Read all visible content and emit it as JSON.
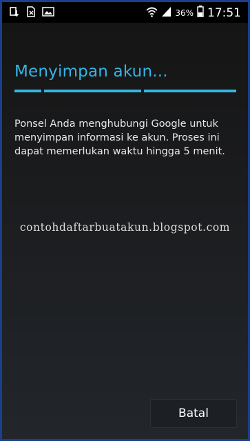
{
  "status_bar": {
    "left_icons": [
      "usb-download-icon",
      "sim-card-icon",
      "image-icon"
    ],
    "right_icons": [
      "wifi-icon",
      "signal-icon",
      "battery-icon"
    ],
    "battery_percent": "36%",
    "time": "17:51"
  },
  "dialog": {
    "title": "Menyimpan akun...",
    "message": "Ponsel Anda menghubungi Google untuk menyimpan informasi ke akun. Proses ini dapat memerlukan waktu hingga 5 menit.",
    "cancel_label": "Batal"
  },
  "watermark": "contohdaftarbuatakun.blogspot.com",
  "colors": {
    "accent": "#35b5e5",
    "frame_border": "#1a3f8f",
    "text": "#e8e8e8"
  }
}
